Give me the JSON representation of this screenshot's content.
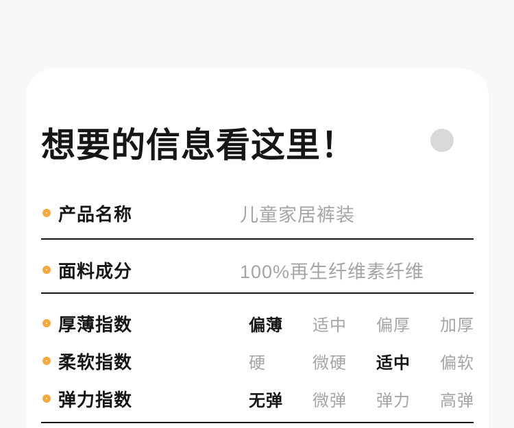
{
  "colors": {
    "page_bg": "#f8f8f8",
    "card_bg": "#ffffff",
    "text_dark": "#161616",
    "text_muted": "#a5a5a5",
    "accent": "#f3a93d",
    "ring_gray": "#d9d9d9",
    "divider": "#161616"
  },
  "header": {
    "title": "想要的信息看这里！"
  },
  "info_rows": [
    {
      "label": "产品名称",
      "value": "儿童家居裤装"
    },
    {
      "label": "面料成分",
      "value": "100%再生纤维素纤维"
    }
  ],
  "index_rows": [
    {
      "label": "厚薄指数",
      "options": [
        {
          "text": "偏薄",
          "selected": true
        },
        {
          "text": "适中",
          "selected": false
        },
        {
          "text": "偏厚",
          "selected": false
        },
        {
          "text": "加厚",
          "selected": false
        }
      ]
    },
    {
      "label": "柔软指数",
      "options": [
        {
          "text": "硬",
          "selected": false
        },
        {
          "text": "微硬",
          "selected": false
        },
        {
          "text": "适中",
          "selected": true
        },
        {
          "text": "偏软",
          "selected": false
        }
      ]
    },
    {
      "label": "弹力指数",
      "options": [
        {
          "text": "无弹",
          "selected": true
        },
        {
          "text": "微弹",
          "selected": false
        },
        {
          "text": "弹力",
          "selected": false
        },
        {
          "text": "高弹",
          "selected": false
        }
      ]
    }
  ]
}
